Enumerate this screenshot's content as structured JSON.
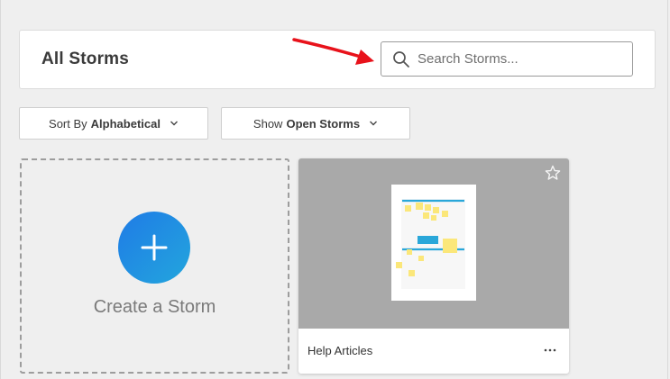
{
  "header": {
    "title": "All Storms",
    "search": {
      "placeholder": "Search Storms...",
      "value": ""
    }
  },
  "filters": {
    "sort": {
      "label": "Sort By",
      "value": "Alphabetical"
    },
    "show": {
      "label": "Show",
      "value": "Open Storms"
    }
  },
  "create_card": {
    "label": "Create a Storm",
    "icon": "plus-icon"
  },
  "storms": [
    {
      "name": "Help Articles",
      "starred": false
    }
  ],
  "colors": {
    "background": "#efefef",
    "accent_blue_start": "#1f7be6",
    "accent_blue_end": "#23a6dd",
    "annotation_arrow": "#e8121b",
    "sticky_yellow": "#fbe77a",
    "sticky_blue": "#2aa7d9"
  }
}
